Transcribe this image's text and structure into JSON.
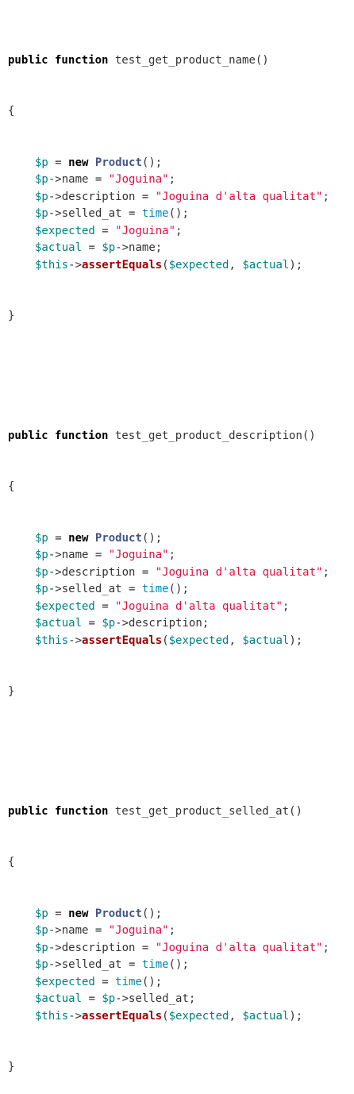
{
  "functions": [
    {
      "header": {
        "kw": "public function",
        "name": "test_get_product_name()"
      },
      "open": "{",
      "lines": [
        [
          [
            "var",
            "$p"
          ],
          [
            "plain",
            " = "
          ],
          [
            "kw",
            "new"
          ],
          [
            "plain",
            " "
          ],
          [
            "cls",
            "Product"
          ],
          [
            "plain",
            "();"
          ]
        ],
        [
          [
            "var",
            "$p"
          ],
          [
            "plain",
            "->name = "
          ],
          [
            "str",
            "\"Joguina\""
          ],
          [
            "plain",
            ";"
          ]
        ],
        [
          [
            "var",
            "$p"
          ],
          [
            "plain",
            "->description = "
          ],
          [
            "str",
            "\"Joguina d'alta qualitat\""
          ],
          [
            "plain",
            ";"
          ]
        ],
        [
          [
            "var",
            "$p"
          ],
          [
            "plain",
            "->selled_at = "
          ],
          [
            "fn",
            "time"
          ],
          [
            "plain",
            "();"
          ]
        ],
        [
          [
            "var",
            "$expected"
          ],
          [
            "plain",
            " = "
          ],
          [
            "str",
            "\"Joguina\""
          ],
          [
            "plain",
            ";"
          ]
        ],
        [
          [
            "var",
            "$actual"
          ],
          [
            "plain",
            " = "
          ],
          [
            "var",
            "$p"
          ],
          [
            "plain",
            "->name;"
          ]
        ],
        [
          [
            "var",
            "$this"
          ],
          [
            "plain",
            "->"
          ],
          [
            "call",
            "assertEquals"
          ],
          [
            "plain",
            "("
          ],
          [
            "var",
            "$expected"
          ],
          [
            "plain",
            ", "
          ],
          [
            "var",
            "$actual"
          ],
          [
            "plain",
            ");"
          ]
        ]
      ],
      "close": "}"
    },
    {
      "header": {
        "kw": "public function",
        "name": "test_get_product_description()"
      },
      "open": "{",
      "lines": [
        [
          [
            "var",
            "$p"
          ],
          [
            "plain",
            " = "
          ],
          [
            "kw",
            "new"
          ],
          [
            "plain",
            " "
          ],
          [
            "cls",
            "Product"
          ],
          [
            "plain",
            "();"
          ]
        ],
        [
          [
            "var",
            "$p"
          ],
          [
            "plain",
            "->name = "
          ],
          [
            "str",
            "\"Joguina\""
          ],
          [
            "plain",
            ";"
          ]
        ],
        [
          [
            "var",
            "$p"
          ],
          [
            "plain",
            "->description = "
          ],
          [
            "str",
            "\"Joguina d'alta qualitat\""
          ],
          [
            "plain",
            ";"
          ]
        ],
        [
          [
            "var",
            "$p"
          ],
          [
            "plain",
            "->selled_at = "
          ],
          [
            "fn",
            "time"
          ],
          [
            "plain",
            "();"
          ]
        ],
        [
          [
            "var",
            "$expected"
          ],
          [
            "plain",
            " = "
          ],
          [
            "str",
            "\"Joguina d'alta qualitat\""
          ],
          [
            "plain",
            ";"
          ]
        ],
        [
          [
            "var",
            "$actual"
          ],
          [
            "plain",
            " = "
          ],
          [
            "var",
            "$p"
          ],
          [
            "plain",
            "->description;"
          ]
        ],
        [
          [
            "var",
            "$this"
          ],
          [
            "plain",
            "->"
          ],
          [
            "call",
            "assertEquals"
          ],
          [
            "plain",
            "("
          ],
          [
            "var",
            "$expected"
          ],
          [
            "plain",
            ", "
          ],
          [
            "var",
            "$actual"
          ],
          [
            "plain",
            ");"
          ]
        ]
      ],
      "close": "}"
    },
    {
      "header": {
        "kw": "public function",
        "name": "test_get_product_selled_at()"
      },
      "open": "{",
      "lines": [
        [
          [
            "var",
            "$p"
          ],
          [
            "plain",
            " = "
          ],
          [
            "kw",
            "new"
          ],
          [
            "plain",
            " "
          ],
          [
            "cls",
            "Product"
          ],
          [
            "plain",
            "();"
          ]
        ],
        [
          [
            "var",
            "$p"
          ],
          [
            "plain",
            "->name = "
          ],
          [
            "str",
            "\"Joguina\""
          ],
          [
            "plain",
            ";"
          ]
        ],
        [
          [
            "var",
            "$p"
          ],
          [
            "plain",
            "->description = "
          ],
          [
            "str",
            "\"Joguina d'alta qualitat\""
          ],
          [
            "plain",
            ";"
          ]
        ],
        [
          [
            "var",
            "$p"
          ],
          [
            "plain",
            "->selled_at = "
          ],
          [
            "fn",
            "time"
          ],
          [
            "plain",
            "();"
          ]
        ],
        [
          [
            "var",
            "$expected"
          ],
          [
            "plain",
            " = "
          ],
          [
            "fn",
            "time"
          ],
          [
            "plain",
            "();"
          ]
        ],
        [
          [
            "var",
            "$actual"
          ],
          [
            "plain",
            " = "
          ],
          [
            "var",
            "$p"
          ],
          [
            "plain",
            "->selled_at;"
          ]
        ],
        [
          [
            "var",
            "$this"
          ],
          [
            "plain",
            "->"
          ],
          [
            "call",
            "assertEquals"
          ],
          [
            "plain",
            "("
          ],
          [
            "var",
            "$expected"
          ],
          [
            "plain",
            ", "
          ],
          [
            "var",
            "$actual"
          ],
          [
            "plain",
            ");"
          ]
        ]
      ],
      "close": "}"
    }
  ]
}
